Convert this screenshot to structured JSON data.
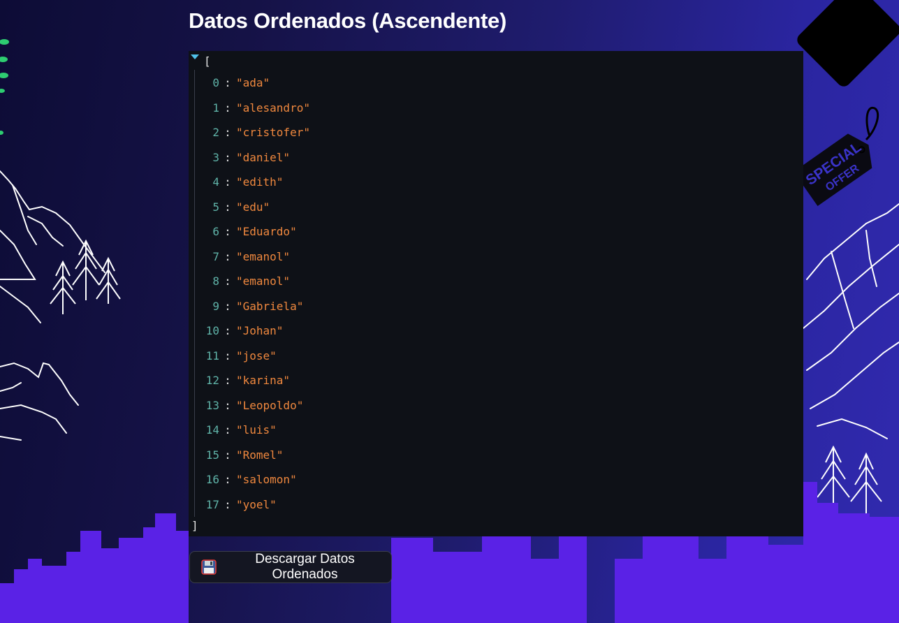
{
  "page": {
    "title": "Datos Ordenados (Ascendente)"
  },
  "json_viewer": {
    "open_bracket": "[",
    "close_bracket": "]",
    "items": [
      {
        "index": "0",
        "value": "\"ada\""
      },
      {
        "index": "1",
        "value": "\"alesandro\""
      },
      {
        "index": "2",
        "value": "\"cristofer\""
      },
      {
        "index": "3",
        "value": "\"daniel\""
      },
      {
        "index": "4",
        "value": "\"edith\""
      },
      {
        "index": "5",
        "value": "\"edu\""
      },
      {
        "index": "6",
        "value": "\"Eduardo\""
      },
      {
        "index": "7",
        "value": "\"emanol\""
      },
      {
        "index": "8",
        "value": "\"emanol\""
      },
      {
        "index": "9",
        "value": "\"Gabriela\""
      },
      {
        "index": "10",
        "value": "\"Johan\""
      },
      {
        "index": "11",
        "value": "\"jose\""
      },
      {
        "index": "12",
        "value": "\"karina\""
      },
      {
        "index": "13",
        "value": "\"Leopoldo\""
      },
      {
        "index": "14",
        "value": "\"luis\""
      },
      {
        "index": "15",
        "value": "\"Romel\""
      },
      {
        "index": "16",
        "value": "\"salomon\""
      },
      {
        "index": "17",
        "value": "\"yoel\""
      }
    ]
  },
  "download_button": {
    "label": "Descargar Datos Ordenados",
    "icon": "floppy-disk-icon"
  },
  "background": {
    "tag_text_1": "SPECIAL",
    "tag_text_2": "OFFER"
  },
  "colors": {
    "index": "#5fb3a8",
    "string": "#f0883e",
    "panel_bg": "#0e1117",
    "city_silhouette": "#5a22e6"
  }
}
